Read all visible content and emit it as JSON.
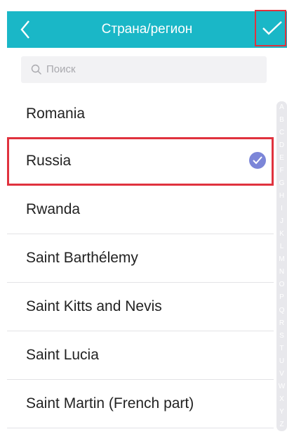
{
  "header": {
    "title": "Страна/регион",
    "back_icon": "chevron-left-icon",
    "confirm_icon": "check-icon"
  },
  "search": {
    "placeholder": "Поиск",
    "icon": "search-icon"
  },
  "countries": [
    {
      "name": "Romania",
      "selected": false
    },
    {
      "name": "Russia",
      "selected": true
    },
    {
      "name": "Rwanda",
      "selected": false
    },
    {
      "name": "Saint Barthélemy",
      "selected": false
    },
    {
      "name": "Saint Kitts and Nevis",
      "selected": false
    },
    {
      "name": "Saint Lucia",
      "selected": false
    },
    {
      "name": "Saint Martin (French part)",
      "selected": false
    }
  ],
  "index_letters": [
    "A",
    "B",
    "C",
    "D",
    "E",
    "F",
    "G",
    "H",
    "I",
    "J",
    "K",
    "L",
    "M",
    "N",
    "O",
    "P",
    "Q",
    "R",
    "S",
    "T",
    "U",
    "V",
    "W",
    "X",
    "Y",
    "Z"
  ],
  "colors": {
    "header_bg": "#1ab7c7",
    "highlight": "#e0323e",
    "check_badge": "#7c86d8"
  }
}
